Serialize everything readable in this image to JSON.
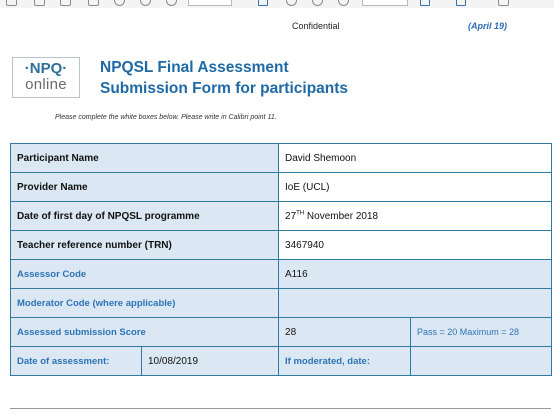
{
  "header": {
    "confidential": "Confidential",
    "date_tag": "(April 19)"
  },
  "logo": {
    "top": "·NPQ·",
    "bottom": "online"
  },
  "title": {
    "line1": "NPQSL Final Assessment",
    "line2": "Submission Form for participants"
  },
  "instruction": "Please complete the white boxes below. Please write in Calibri point 11.",
  "form": {
    "participant_name_label": "Participant Name",
    "participant_name_value": "David Shemoon",
    "provider_name_label": "Provider Name",
    "provider_name_value": "IoE (UCL)",
    "first_day_label": "Date of first day of NPQSL programme",
    "first_day_day": "27",
    "first_day_suffix": "TH",
    "first_day_rest": " November 2018",
    "trn_label": "Teacher reference number (TRN)",
    "trn_value": "3467940",
    "assessor_code_label": "Assessor Code",
    "assessor_code_value": "A116",
    "moderator_code_label": "Moderator Code (where applicable)",
    "moderator_code_value": "",
    "score_label": "Assessed submission Score",
    "score_value": "28",
    "score_note": "Pass = 20 Maximum = 28",
    "assessment_date_label": "Date of assessment:",
    "assessment_date_value": "10/08/2019",
    "moderated_date_label": "If moderated, date:",
    "moderated_date_value": ""
  },
  "colors": {
    "accent_blue": "#1f6aa5",
    "label_background": "#dbe8f3",
    "border": "#2e7aa0"
  }
}
